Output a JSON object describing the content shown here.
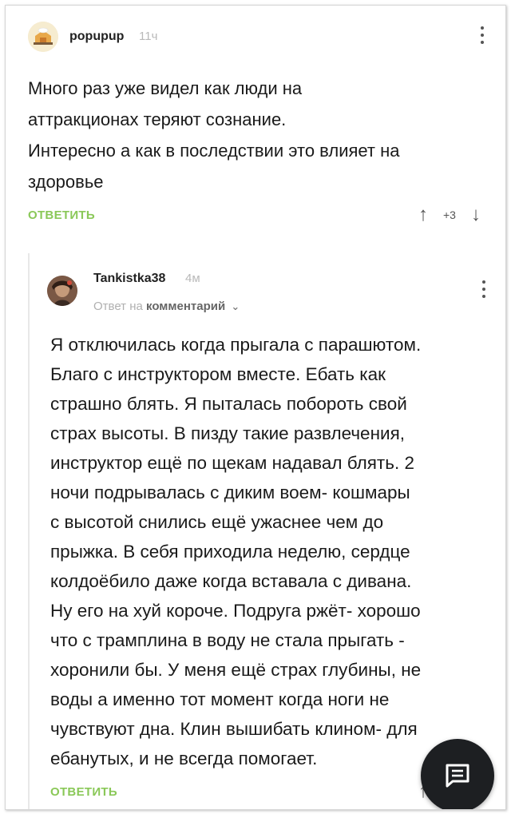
{
  "comment1": {
    "username": "popupup",
    "time": "11ч",
    "lines": [
      "Много раз уже видел как люди на",
      "аттракционах теряют сознание.",
      "Интересно а как в последствии это влияет на",
      "здоровье"
    ],
    "reply_label": "ОТВЕТИТЬ",
    "score": "+3"
  },
  "comment2": {
    "username": "Tankistka38",
    "time": "4м",
    "reply_to_prefix": "Ответ на",
    "reply_to_target": "комментарий",
    "lines": [
      "Я отключилась когда прыгала с парашютом.",
      "Благо с инструктором вместе. Ебать как",
      "страшно блять. Я пыталась побороть свой",
      "страх высоты. В пизду такие развлечения,",
      "инструктор ещё по щекам надавал блять. 2",
      "ночи подрывалась с диким воем- кошмары",
      "с высотой снились ещё ужаснее чем до",
      "прыжка. В себя приходила неделю, сердце",
      "колдоёбило даже когда вставала с дивана.",
      "Ну его на хуй короче. Подруга ржёт- хорошо",
      "что с трамплина в воду не стала прыгать -",
      "хоронили бы. У меня ещё страх глубины, не",
      "воды а именно тот момент когда ноги не",
      "чувствуют дна. Клин вышибать клином- для",
      "ебанутых, и не всегда помогает."
    ],
    "reply_label": "ОТВЕТИТЬ"
  },
  "icons": {
    "upvote": "arrow-up-icon",
    "downvote": "arrow-down-icon",
    "menu": "more-vertical-icon",
    "fab": "chat-icon"
  },
  "colors": {
    "accent": "#8ac858",
    "fab_bg": "#1d1f22"
  }
}
